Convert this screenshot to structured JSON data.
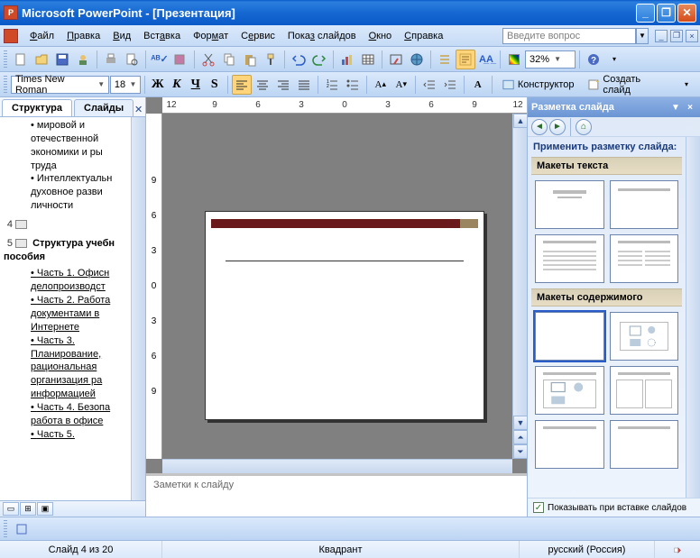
{
  "title": "Microsoft PowerPoint - [Презентация]",
  "menu": [
    "Файл",
    "Правка",
    "Вид",
    "Вставка",
    "Формат",
    "Сервис",
    "Показ слайдов",
    "Окно",
    "Справка"
  ],
  "menu_accel": [
    "Ф",
    "П",
    "В",
    "а",
    "Ф",
    "С",
    "з",
    "О",
    "С"
  ],
  "ask_placeholder": "Введите вопрос",
  "font_name": "Times New Roman",
  "font_size": "18",
  "zoom": "32%",
  "designer_label": "Конструктор",
  "new_slide_label": "Создать слайд",
  "tabs": {
    "outline": "Структура",
    "slides": "Слайды"
  },
  "ruler_h": [
    "12",
    "9",
    "6",
    "3",
    "0",
    "3",
    "6",
    "9",
    "12"
  ],
  "ruler_v": [
    "9",
    "6",
    "3",
    "0",
    "3",
    "6",
    "9"
  ],
  "outline": {
    "bullets_above": [
      "мировой и отечественной экономики и ры труда",
      "Интеллектуальн духовное разви личности"
    ],
    "slide4_num": "4",
    "slide5_num": "5",
    "slide5_title": "Структура учебн пособия",
    "parts": [
      "Часть 1. Офисн делопроизводст",
      "Часть 2. Работа документами в Интернете",
      "Часть 3. Планирование, рациональная организация ра информацией",
      "Часть 4. Безопа работа в офисе",
      "Часть 5."
    ]
  },
  "notes_placeholder": "Заметки к слайду",
  "task_pane": {
    "title": "Разметка слайда",
    "apply": "Применить разметку слайда:",
    "section1": "Макеты текста",
    "section2": "Макеты содержимого",
    "show_on_insert": "Показывать при вставке слайдов"
  },
  "status": {
    "slide": "Слайд 4 из 20",
    "template": "Квадрант",
    "lang": "русский (Россия)"
  }
}
